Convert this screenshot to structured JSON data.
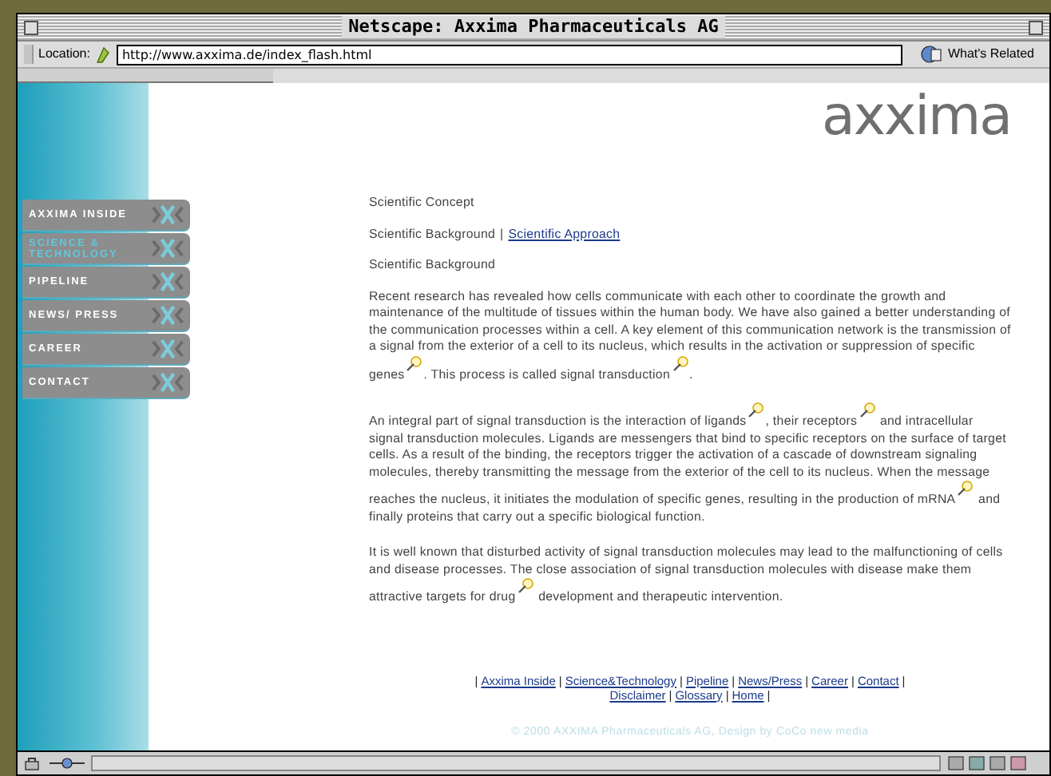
{
  "window": {
    "title": "Netscape: Axxima Pharmaceuticals AG"
  },
  "location_bar": {
    "label": "Location:",
    "url": "http://www.axxima.de/index_flash.html",
    "related": "What's Related"
  },
  "logo": {
    "text": "axxima"
  },
  "nav": [
    {
      "label": "AXXIMA INSIDE",
      "selected": false
    },
    {
      "label": "SCIENCE & TECHNOLOGY",
      "selected": true
    },
    {
      "label": "PIPELINE",
      "selected": false
    },
    {
      "label": "NEWS/ PRESS",
      "selected": false
    },
    {
      "label": "CAREER",
      "selected": false
    },
    {
      "label": "CONTACT",
      "selected": false
    }
  ],
  "content": {
    "heading": "Scientific Concept",
    "subnav": [
      {
        "label": "Scientific Background",
        "selected": true
      },
      {
        "label": "Scientific Approach",
        "selected": false
      }
    ],
    "subnav_separator": "|",
    "section_title": "Scientific Background",
    "paragraphs": [
      [
        {
          "kind": "text",
          "text": "Recent research has revealed how cells communicate with each other to coordinate the growth and maintenance of the multitude of tissues within the human body. We have also gained a better understanding of the communication processes within a cell. A key element of this communication network is the transmission of a signal from the exterior of a cell to its nucleus, which results in the activation or suppression of specific genes"
        },
        {
          "kind": "glossary_icon"
        },
        {
          "kind": "text",
          "text": ". This process is called signal transduction"
        },
        {
          "kind": "glossary_icon"
        },
        {
          "kind": "text",
          "text": "."
        }
      ],
      [
        {
          "kind": "text",
          "text": "An integral part of signal transduction is the interaction of ligands"
        },
        {
          "kind": "glossary_icon"
        },
        {
          "kind": "text",
          "text": ", their receptors"
        },
        {
          "kind": "glossary_icon"
        },
        {
          "kind": "text",
          "text": " and intracellular signal transduction molecules. Ligands are messengers that bind to specific receptors on the surface of target cells. As a result of the binding, the receptors trigger the activation of a cascade of downstream signaling molecules, thereby transmitting the message from the exterior of the cell to its nucleus. When the message reaches the nucleus, it initiates the modulation of specific genes, resulting in the production of mRNA"
        },
        {
          "kind": "glossary_icon"
        },
        {
          "kind": "text",
          "text": " and finally proteins that carry out a specific biological function."
        }
      ],
      [
        {
          "kind": "text",
          "text": "It is well known that disturbed activity of signal transduction molecules may lead to the malfunctioning of cells and disease processes. The close association of signal transduction molecules with disease make them attractive targets for drug"
        },
        {
          "kind": "glossary_icon"
        },
        {
          "kind": "text",
          "text": " development and therapeutic intervention."
        }
      ]
    ]
  },
  "footer": {
    "separator": "|",
    "lines": [
      {
        "links": [
          "Axxima Inside",
          "Science&Technology",
          "Pipeline",
          "News/Press",
          "Career",
          "Contact"
        ]
      },
      {
        "links": [
          "Disclaimer",
          "Glossary",
          "Home"
        ]
      }
    ],
    "copyright": "© 2000 AXXIMA Pharmaceuticals AG, Design by CoCo new media"
  }
}
